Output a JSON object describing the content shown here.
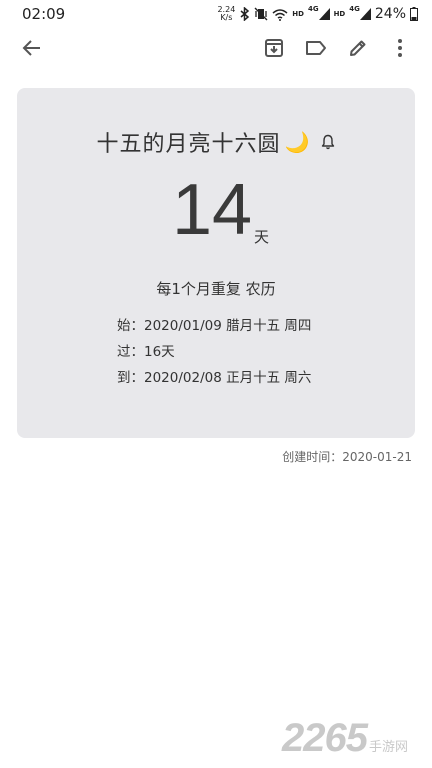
{
  "status_bar": {
    "time": "02:09",
    "net_speed_value": "2.24",
    "net_speed_unit": "K/s",
    "hd_label_1": "HD",
    "signal_1_label": "4G",
    "hd_label_2": "HD",
    "signal_2_label": "4G",
    "battery": "24%"
  },
  "toolbar": {
    "icons": [
      "back-arrow-icon",
      "archive-icon",
      "label-icon",
      "edit-icon",
      "more-icon"
    ]
  },
  "card": {
    "title": "十五的月亮十六圆",
    "title_emoji": "🌙",
    "count": "14",
    "count_unit": "天",
    "repeat": "每1个月重复 农历",
    "start": "始：2020/01/09 腊月十五 周四",
    "passed": "过：16天",
    "end": "到：2020/02/08 正月十五 周六"
  },
  "created": "创建时间：2020-01-21",
  "watermark": {
    "number": "2265",
    "text": "手游网"
  },
  "colors": {
    "card_background": "#e8e8eb",
    "moon": "#f2c230",
    "watermark": "#c9c9c9"
  }
}
